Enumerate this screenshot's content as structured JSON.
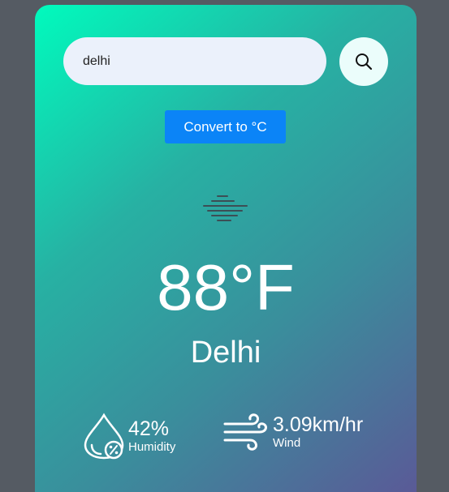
{
  "search": {
    "value": "delhi",
    "icon": "search-icon"
  },
  "convert_button": {
    "label": "Convert to °C",
    "color": "#0b84f7"
  },
  "weather": {
    "icon": "mist-icon",
    "temperature": "88°F",
    "city": "Delhi"
  },
  "details": {
    "humidity": {
      "icon": "humidity-icon",
      "value": "42%",
      "label": "Humidity"
    },
    "wind": {
      "icon": "wind-icon",
      "value": "3.09km/hr",
      "label": "Wind"
    }
  },
  "colors": {
    "background": "#555b63",
    "gradient_start": "#00fbbd",
    "gradient_end": "#5a5a97"
  }
}
